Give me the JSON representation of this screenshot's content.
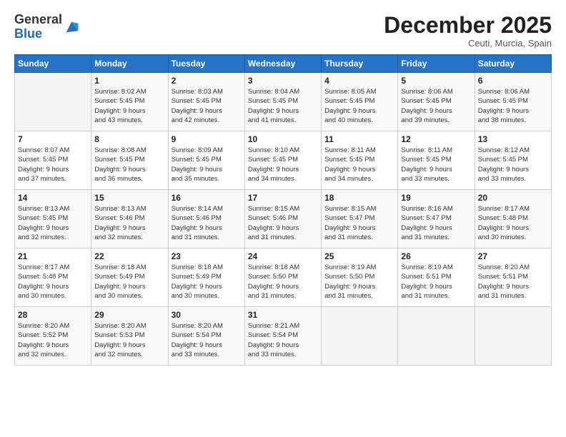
{
  "header": {
    "logo_general": "General",
    "logo_blue": "Blue",
    "month_title": "December 2025",
    "location": "Ceuti, Murcia, Spain"
  },
  "days_of_week": [
    "Sunday",
    "Monday",
    "Tuesday",
    "Wednesday",
    "Thursday",
    "Friday",
    "Saturday"
  ],
  "weeks": [
    [
      {
        "day": "",
        "info": ""
      },
      {
        "day": "1",
        "info": "Sunrise: 8:02 AM\nSunset: 5:45 PM\nDaylight: 9 hours\nand 43 minutes."
      },
      {
        "day": "2",
        "info": "Sunrise: 8:03 AM\nSunset: 5:45 PM\nDaylight: 9 hours\nand 42 minutes."
      },
      {
        "day": "3",
        "info": "Sunrise: 8:04 AM\nSunset: 5:45 PM\nDaylight: 9 hours\nand 41 minutes."
      },
      {
        "day": "4",
        "info": "Sunrise: 8:05 AM\nSunset: 5:45 PM\nDaylight: 9 hours\nand 40 minutes."
      },
      {
        "day": "5",
        "info": "Sunrise: 8:06 AM\nSunset: 5:45 PM\nDaylight: 9 hours\nand 39 minutes."
      },
      {
        "day": "6",
        "info": "Sunrise: 8:06 AM\nSunset: 5:45 PM\nDaylight: 9 hours\nand 38 minutes."
      }
    ],
    [
      {
        "day": "7",
        "info": "Sunrise: 8:07 AM\nSunset: 5:45 PM\nDaylight: 9 hours\nand 37 minutes."
      },
      {
        "day": "8",
        "info": "Sunrise: 8:08 AM\nSunset: 5:45 PM\nDaylight: 9 hours\nand 36 minutes."
      },
      {
        "day": "9",
        "info": "Sunrise: 8:09 AM\nSunset: 5:45 PM\nDaylight: 9 hours\nand 35 minutes."
      },
      {
        "day": "10",
        "info": "Sunrise: 8:10 AM\nSunset: 5:45 PM\nDaylight: 9 hours\nand 34 minutes."
      },
      {
        "day": "11",
        "info": "Sunrise: 8:11 AM\nSunset: 5:45 PM\nDaylight: 9 hours\nand 34 minutes."
      },
      {
        "day": "12",
        "info": "Sunrise: 8:11 AM\nSunset: 5:45 PM\nDaylight: 9 hours\nand 33 minutes."
      },
      {
        "day": "13",
        "info": "Sunrise: 8:12 AM\nSunset: 5:45 PM\nDaylight: 9 hours\nand 33 minutes."
      }
    ],
    [
      {
        "day": "14",
        "info": "Sunrise: 8:13 AM\nSunset: 5:45 PM\nDaylight: 9 hours\nand 32 minutes."
      },
      {
        "day": "15",
        "info": "Sunrise: 8:13 AM\nSunset: 5:46 PM\nDaylight: 9 hours\nand 32 minutes."
      },
      {
        "day": "16",
        "info": "Sunrise: 8:14 AM\nSunset: 5:46 PM\nDaylight: 9 hours\nand 31 minutes."
      },
      {
        "day": "17",
        "info": "Sunrise: 8:15 AM\nSunset: 5:46 PM\nDaylight: 9 hours\nand 31 minutes."
      },
      {
        "day": "18",
        "info": "Sunrise: 8:15 AM\nSunset: 5:47 PM\nDaylight: 9 hours\nand 31 minutes."
      },
      {
        "day": "19",
        "info": "Sunrise: 8:16 AM\nSunset: 5:47 PM\nDaylight: 9 hours\nand 31 minutes."
      },
      {
        "day": "20",
        "info": "Sunrise: 8:17 AM\nSunset: 5:48 PM\nDaylight: 9 hours\nand 30 minutes."
      }
    ],
    [
      {
        "day": "21",
        "info": "Sunrise: 8:17 AM\nSunset: 5:48 PM\nDaylight: 9 hours\nand 30 minutes."
      },
      {
        "day": "22",
        "info": "Sunrise: 8:18 AM\nSunset: 5:49 PM\nDaylight: 9 hours\nand 30 minutes."
      },
      {
        "day": "23",
        "info": "Sunrise: 8:18 AM\nSunset: 5:49 PM\nDaylight: 9 hours\nand 30 minutes."
      },
      {
        "day": "24",
        "info": "Sunrise: 8:18 AM\nSunset: 5:50 PM\nDaylight: 9 hours\nand 31 minutes."
      },
      {
        "day": "25",
        "info": "Sunrise: 8:19 AM\nSunset: 5:50 PM\nDaylight: 9 hours\nand 31 minutes."
      },
      {
        "day": "26",
        "info": "Sunrise: 8:19 AM\nSunset: 5:51 PM\nDaylight: 9 hours\nand 31 minutes."
      },
      {
        "day": "27",
        "info": "Sunrise: 8:20 AM\nSunset: 5:51 PM\nDaylight: 9 hours\nand 31 minutes."
      }
    ],
    [
      {
        "day": "28",
        "info": "Sunrise: 8:20 AM\nSunset: 5:52 PM\nDaylight: 9 hours\nand 32 minutes."
      },
      {
        "day": "29",
        "info": "Sunrise: 8:20 AM\nSunset: 5:53 PM\nDaylight: 9 hours\nand 32 minutes."
      },
      {
        "day": "30",
        "info": "Sunrise: 8:20 AM\nSunset: 5:54 PM\nDaylight: 9 hours\nand 33 minutes."
      },
      {
        "day": "31",
        "info": "Sunrise: 8:21 AM\nSunset: 5:54 PM\nDaylight: 9 hours\nand 33 minutes."
      },
      {
        "day": "",
        "info": ""
      },
      {
        "day": "",
        "info": ""
      },
      {
        "day": "",
        "info": ""
      }
    ]
  ]
}
